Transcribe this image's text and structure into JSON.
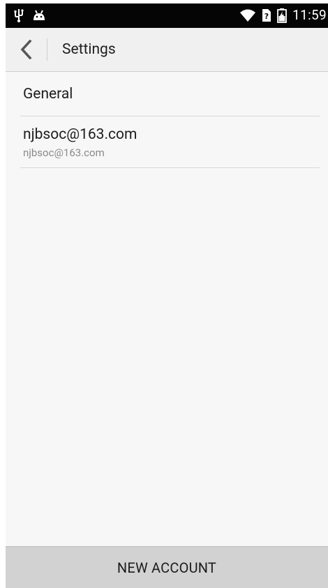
{
  "status_bar": {
    "time": "11:59",
    "icons": [
      "usb-icon",
      "android-debug-icon",
      "wifi-icon",
      "sim-unknown-icon",
      "battery-charging-icon"
    ]
  },
  "action_bar": {
    "back_icon": "chevron-left-icon",
    "title": "Settings"
  },
  "settings_list": {
    "general": {
      "title": "General"
    },
    "account": {
      "title": "njbsoc@163.com",
      "subtitle": "njbsoc@163.com"
    }
  },
  "footer": {
    "new_account_label": "NEW ACCOUNT"
  },
  "colors": {
    "status_bar_bg": "#050505",
    "screen_bg": "#f7f7f7",
    "action_bar_bg": "#f0f0f0",
    "button_bg": "#d2d2d2",
    "divider": "#d8d8d8",
    "subtitle_text": "#8a8a8a"
  }
}
